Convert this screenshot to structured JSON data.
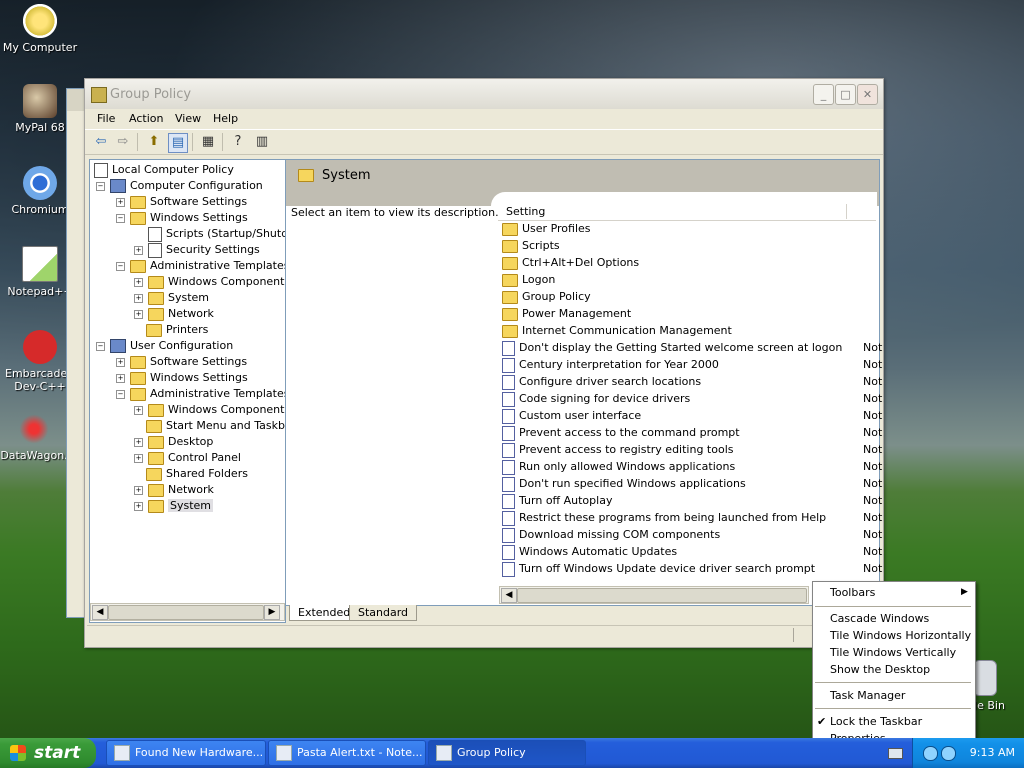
{
  "desktop": {
    "icons": [
      {
        "label": "My Computer"
      },
      {
        "label": "MyPal 68"
      },
      {
        "label": "Chromium"
      },
      {
        "label": "Notepad++"
      },
      {
        "label": "Embarcadero Dev-C++"
      },
      {
        "label": "DataWagon."
      },
      {
        "label": "le Bin"
      }
    ]
  },
  "window": {
    "title": "Group Policy",
    "menu": [
      "File",
      "Action",
      "View",
      "Help"
    ],
    "tree": [
      {
        "label": "Local Computer Policy",
        "icon": "doc"
      },
      {
        "label": "Computer Configuration",
        "icon": "pc"
      },
      {
        "label": "Software Settings",
        "icon": "folder"
      },
      {
        "label": "Windows Settings",
        "icon": "folder"
      },
      {
        "label": "Scripts (Startup/Shutdown)",
        "icon": "doc"
      },
      {
        "label": "Security Settings",
        "icon": "doc"
      },
      {
        "label": "Administrative Templates",
        "icon": "folder"
      },
      {
        "label": "Windows Components",
        "icon": "folder"
      },
      {
        "label": "System",
        "icon": "folder"
      },
      {
        "label": "Network",
        "icon": "folder"
      },
      {
        "label": "Printers",
        "icon": "folder"
      },
      {
        "label": "User Configuration",
        "icon": "pc"
      },
      {
        "label": "Software Settings",
        "icon": "folder"
      },
      {
        "label": "Windows Settings",
        "icon": "folder"
      },
      {
        "label": "Administrative Templates",
        "icon": "folder"
      },
      {
        "label": "Windows Components",
        "icon": "folder"
      },
      {
        "label": "Start Menu and Taskbar",
        "icon": "folder"
      },
      {
        "label": "Desktop",
        "icon": "folder"
      },
      {
        "label": "Control Panel",
        "icon": "folder"
      },
      {
        "label": "Shared Folders",
        "icon": "folder"
      },
      {
        "label": "Network",
        "icon": "folder"
      },
      {
        "label": "System",
        "icon": "folder"
      }
    ],
    "right_title": "System",
    "description": "Select an item to view its description.",
    "column_header": "Setting",
    "folders": [
      "User Profiles",
      "Scripts",
      "Ctrl+Alt+Del Options",
      "Logon",
      "Group Policy",
      "Power Management",
      "Internet Communication Management"
    ],
    "policies": [
      "Don't display the Getting Started welcome screen at logon",
      "Century interpretation for Year 2000",
      "Configure driver search locations",
      "Code signing for device drivers",
      "Custom user interface",
      "Prevent access to the command prompt",
      "Prevent access to registry editing tools",
      "Run only allowed Windows applications",
      "Don't run specified Windows applications",
      "Turn off Autoplay",
      "Restrict these programs from being launched from Help",
      "Download missing COM components",
      "Windows Automatic Updates",
      "Turn off Windows Update device driver search prompt"
    ],
    "state_label": "Not",
    "tabs": [
      "Extended",
      "Standard"
    ]
  },
  "context_menu": {
    "items": [
      "Toolbars",
      "Cascade Windows",
      "Tile Windows Horizontally",
      "Tile Windows Vertically",
      "Show the Desktop",
      "Task Manager",
      "Lock the Taskbar",
      "Properties"
    ]
  },
  "taskbar": {
    "start_label": "start",
    "buttons": [
      "Found New Hardware...",
      "Pasta Alert.txt - Note...",
      "Group Policy"
    ],
    "clock": "9:13 AM"
  }
}
